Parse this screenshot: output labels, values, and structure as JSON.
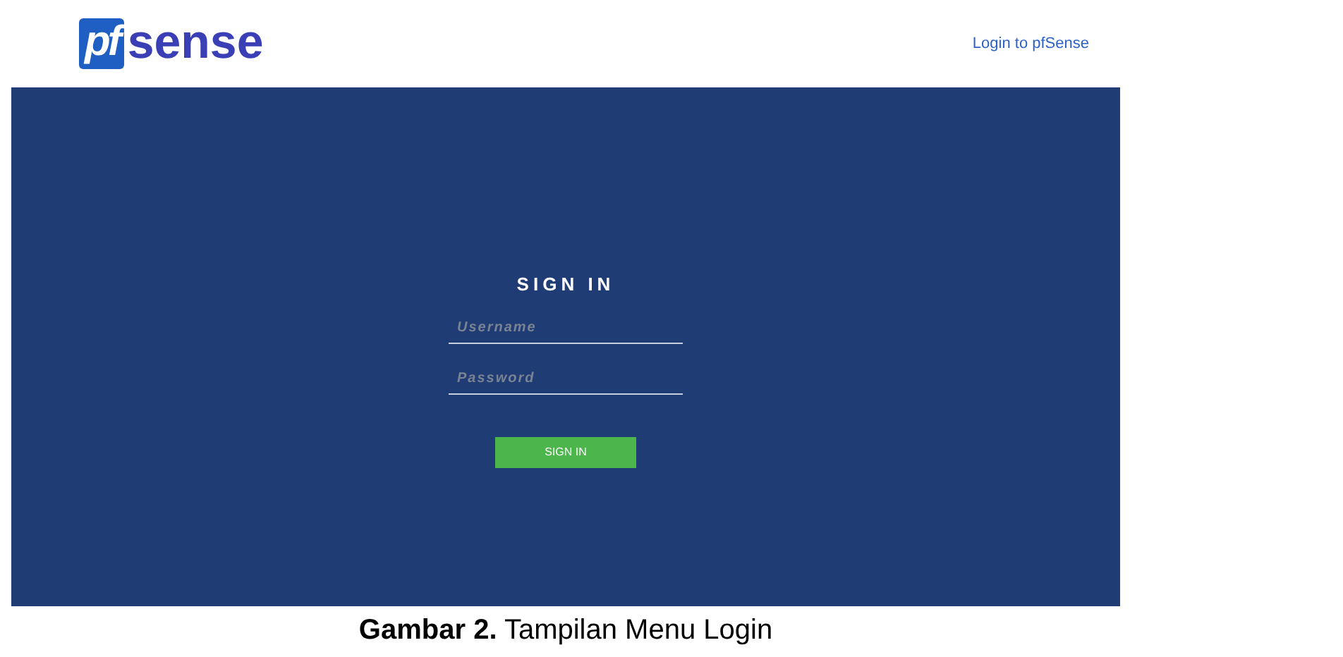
{
  "header": {
    "logo": {
      "mark": "pf",
      "word": "sense"
    },
    "login_link": "Login to pfSense"
  },
  "login_form": {
    "title": "SIGN IN",
    "fields": [
      {
        "placeholder": "Username"
      },
      {
        "placeholder": "Password"
      }
    ],
    "button": "SIGN IN"
  },
  "caption": "**Gambar 2.** Tampilan Menu Login"
}
